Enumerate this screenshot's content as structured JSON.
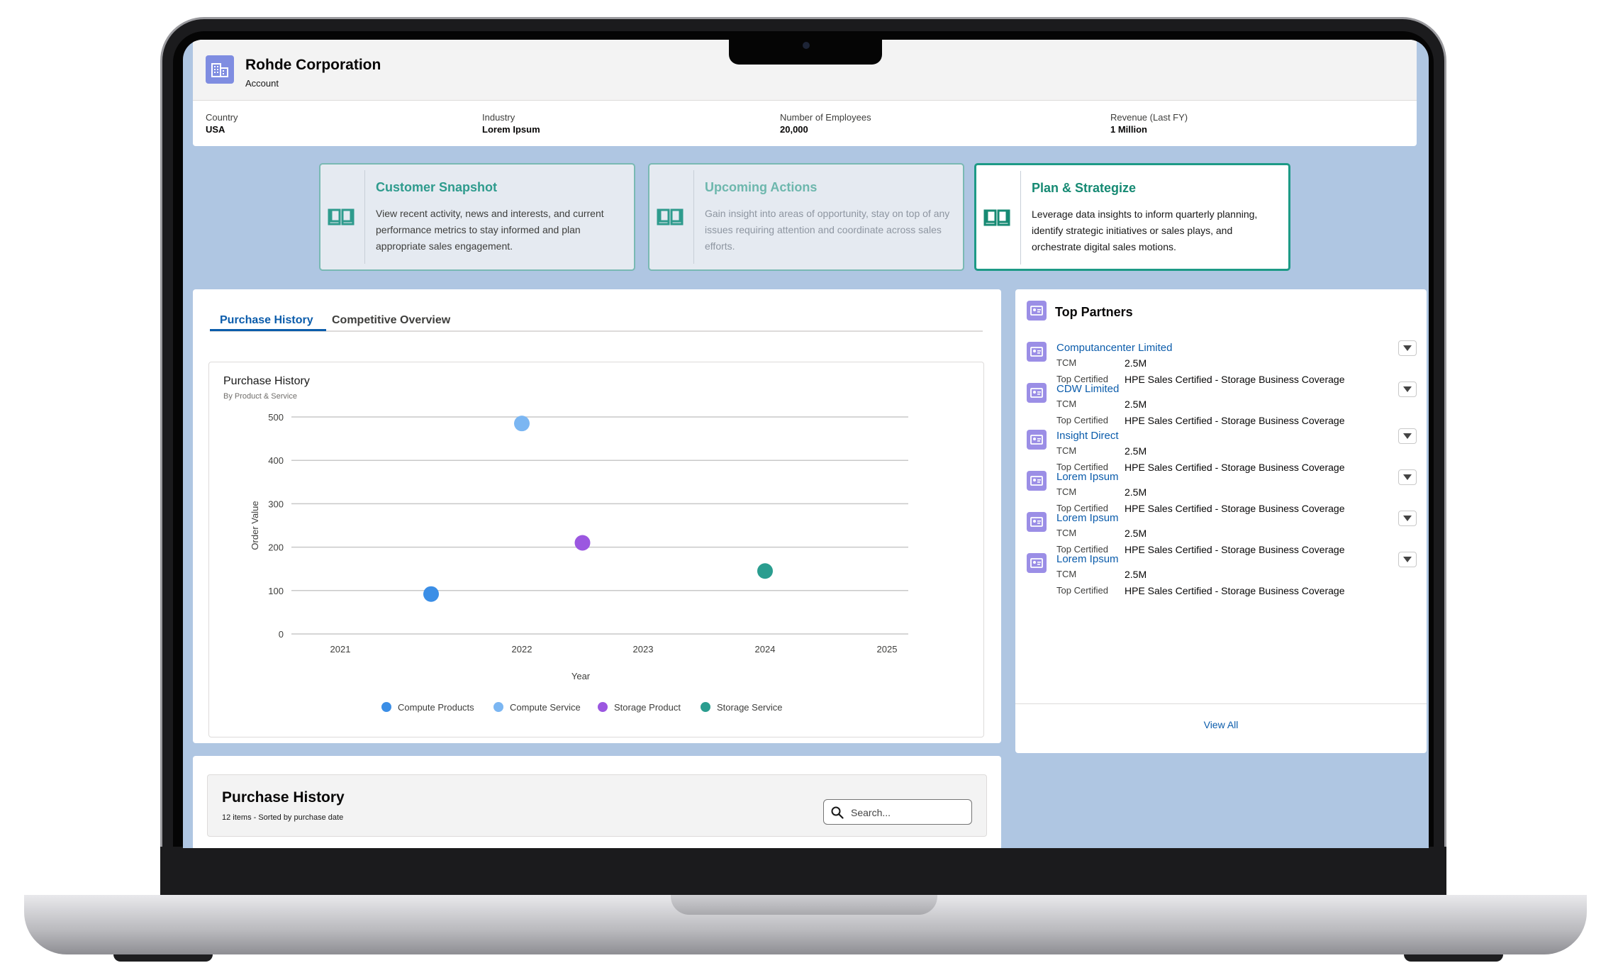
{
  "account": {
    "name": "Rohde Corporation",
    "type": "Account",
    "icon": "building-icon",
    "fields": [
      {
        "label": "Country",
        "value": "USA"
      },
      {
        "label": "Industry",
        "value": "Lorem Ipsum"
      },
      {
        "label": "Number of Employees",
        "value": "20,000"
      },
      {
        "label": "Revenue (Last FY)",
        "value": "1 Million"
      }
    ]
  },
  "cards": [
    {
      "title": "Customer Snapshot",
      "description": "View recent activity, news and interests, and current performance metrics to stay informed and plan appropriate sales engagement.",
      "icon": "book-icon"
    },
    {
      "title": "Upcoming Actions",
      "description": "Gain insight into areas of opportunity, stay on top of any issues requiring attention and coordinate across sales efforts.",
      "icon": "book-icon"
    },
    {
      "title": "Plan & Strategize",
      "description": "Leverage data insights to inform quarterly planning, identify strategic initiatives or sales plays, and orchestrate digital sales motions.",
      "icon": "book-icon"
    }
  ],
  "tabs": [
    "Purchase History",
    "Competitive Overview"
  ],
  "chart": {
    "title": "Purchase History",
    "subtitle": "By Product & Service"
  },
  "chart_data": {
    "type": "scatter",
    "title": "Purchase History",
    "subtitle": "By Product & Service",
    "xlabel": "Year",
    "ylabel": "Order Value",
    "xlim": [
      2021,
      2025
    ],
    "ylim": [
      0,
      500
    ],
    "xticks": [
      "2021",
      "2022",
      "2023",
      "2024",
      "2025"
    ],
    "yticks": [
      "0",
      "100",
      "200",
      "300",
      "400",
      "500"
    ],
    "grid": "horizontal",
    "legend": "bottom",
    "series": [
      {
        "name": "Compute Products",
        "color": "#3b8ee6",
        "points": [
          {
            "x": 2021.5,
            "y": 92
          }
        ]
      },
      {
        "name": "Compute Service",
        "color": "#7bb6f2",
        "points": [
          {
            "x": 2022.0,
            "y": 485
          }
        ]
      },
      {
        "name": "Storage Product",
        "color": "#9b57e0",
        "points": [
          {
            "x": 2022.5,
            "y": 210
          }
        ]
      },
      {
        "name": "Storage Service",
        "color": "#2a9d8f",
        "points": [
          {
            "x": 2024.0,
            "y": 145
          }
        ]
      }
    ]
  },
  "purchase_history": {
    "title": "Purchase History",
    "subtitle": "12 items - Sorted by purchase date",
    "search_placeholder": "Search..."
  },
  "partners": {
    "title": "Top Partners",
    "icon": "partner-icon",
    "tcm_label": "TCM",
    "cert_label": "Top Certified",
    "items": [
      {
        "name": "Computancenter Limited",
        "tcm": "2.5M",
        "certified": "HPE Sales Certified - Storage Business Coverage"
      },
      {
        "name": "CDW Limited",
        "tcm": "2.5M",
        "certified": "HPE Sales Certified - Storage Business Coverage"
      },
      {
        "name": "Insight Direct",
        "tcm": "2.5M",
        "certified": "HPE Sales Certified - Storage Business Coverage"
      },
      {
        "name": "Lorem Ipsum",
        "tcm": "2.5M",
        "certified": "HPE Sales Certified - Storage Business Coverage"
      },
      {
        "name": "Lorem Ipsum",
        "tcm": "2.5M",
        "certified": "HPE Sales Certified - Storage Business Coverage"
      },
      {
        "name": "Lorem Ipsum",
        "tcm": "2.5M",
        "certified": "HPE Sales Certified - Storage Business Coverage"
      }
    ],
    "view_all": "View All"
  },
  "colors": {
    "accent": "#0b5cab",
    "teal": "#168a73",
    "screen_bg": "#afc6e2",
    "icon_purple": "#7f8de1"
  }
}
